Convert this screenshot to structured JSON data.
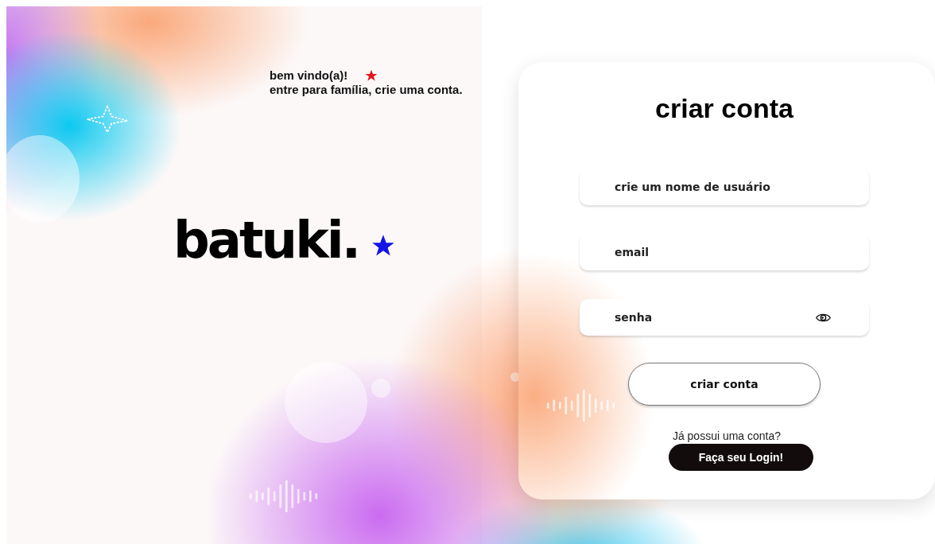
{
  "welcome": {
    "greeting": "bem vindo(a)!",
    "subtitle": "entre para família, crie uma conta."
  },
  "logo": {
    "text": "batuki."
  },
  "form": {
    "title": "criar conta",
    "fields": [
      {
        "kind": "text",
        "placeholder": "crie um nome de usuário"
      },
      {
        "kind": "email",
        "placeholder": "email"
      },
      {
        "kind": "password",
        "placeholder": "senha"
      }
    ],
    "submit": "criar conta",
    "login_prompt": "Já possui uma conta?",
    "login_button": "Faça seu Login!"
  }
}
